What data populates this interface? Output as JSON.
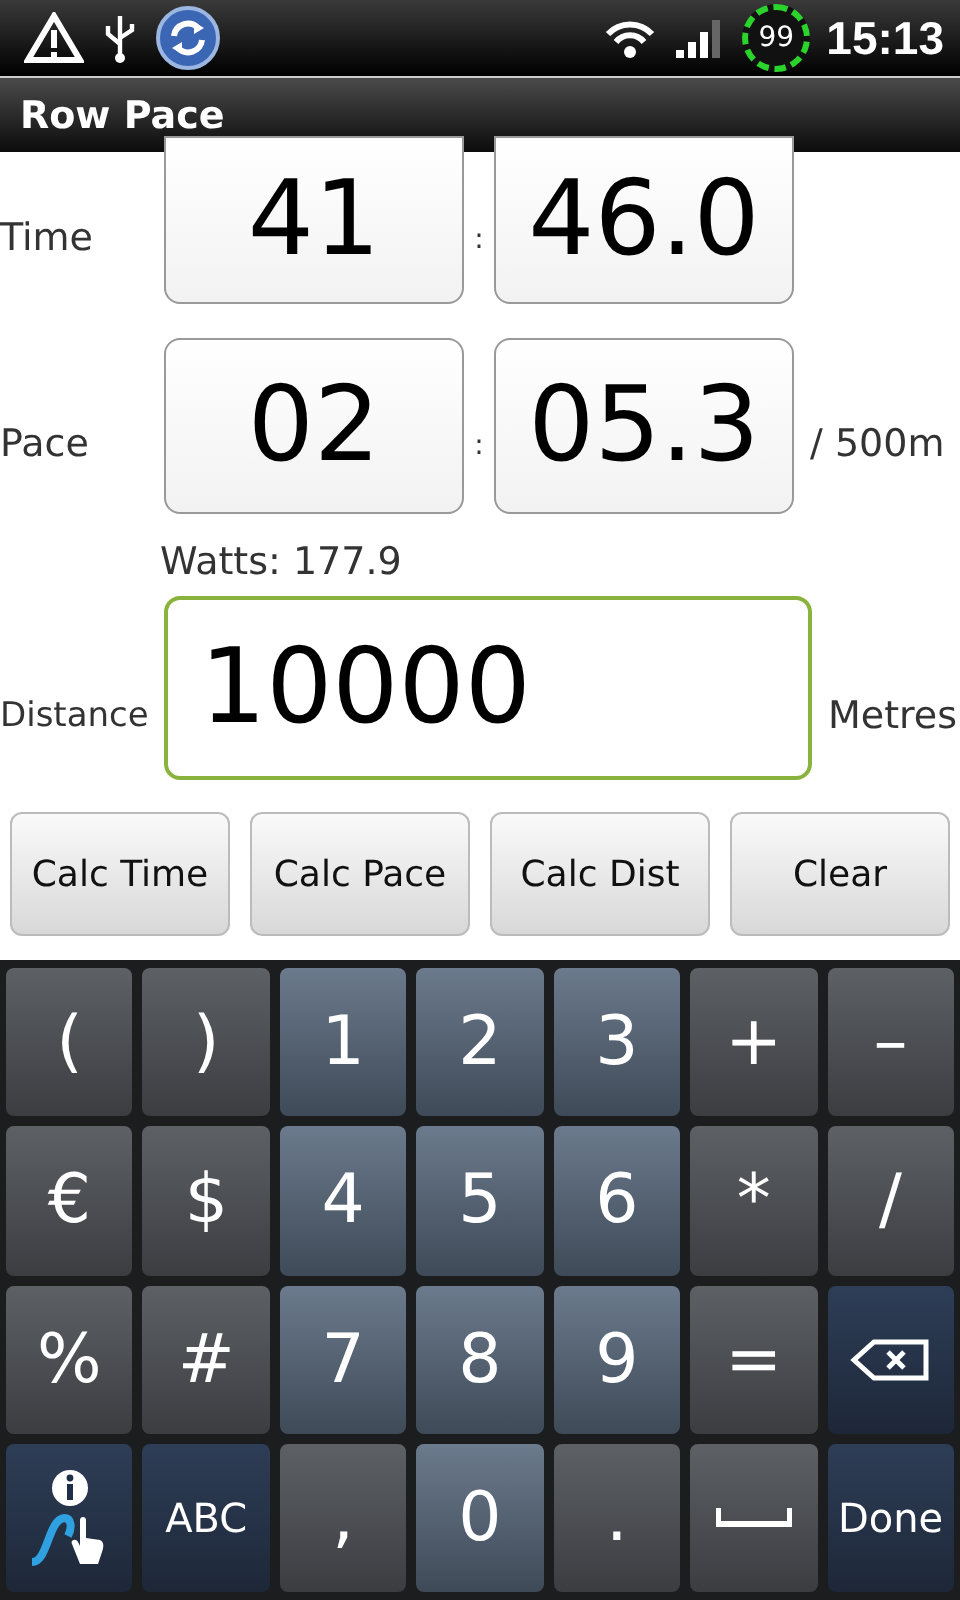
{
  "status_bar": {
    "battery": "99",
    "time": "15:13"
  },
  "title": "Row Pace",
  "rows": [
    {
      "label": "Time",
      "fields": [
        {
          "value": "41",
          "focused": false
        },
        {
          "value": "46.0",
          "focused": false
        }
      ],
      "separator": ":"
    },
    {
      "label": "Pace",
      "fields": [
        {
          "value": "02",
          "focused": false
        },
        {
          "value": "05.3",
          "focused": false
        }
      ],
      "separator": ":",
      "unit": "/ 500m"
    }
  ],
  "watts": "Watts: 177.9",
  "distance": {
    "label": "Distance",
    "value": "10000",
    "focused": true,
    "unit": "Metres"
  },
  "buttons": [
    "Calc Time",
    "Calc Pace",
    "Calc Dist",
    "Clear"
  ],
  "keyboard": [
    {
      "kind": "symbol",
      "label": "("
    },
    {
      "kind": "symbol",
      "label": ")"
    },
    {
      "kind": "digit",
      "label": "1"
    },
    {
      "kind": "digit",
      "label": "2"
    },
    {
      "kind": "digit",
      "label": "3"
    },
    {
      "kind": "symbol",
      "label": "+"
    },
    {
      "kind": "symbol",
      "label": "–"
    },
    {
      "kind": "symbol",
      "label": "€"
    },
    {
      "kind": "symbol",
      "label": "$"
    },
    {
      "kind": "digit",
      "label": "4"
    },
    {
      "kind": "digit",
      "label": "5"
    },
    {
      "kind": "digit",
      "label": "6"
    },
    {
      "kind": "symbol",
      "label": "*"
    },
    {
      "kind": "symbol",
      "label": "/"
    },
    {
      "kind": "symbol",
      "label": "%"
    },
    {
      "kind": "symbol",
      "label": "#"
    },
    {
      "kind": "digit",
      "label": "7"
    },
    {
      "kind": "digit",
      "label": "8"
    },
    {
      "kind": "digit",
      "label": "9"
    },
    {
      "kind": "symbol",
      "label": "="
    },
    {
      "kind": "backspace"
    },
    {
      "kind": "logo"
    },
    {
      "kind": "mode",
      "label": "ABC"
    },
    {
      "kind": "symbol",
      "label": ","
    },
    {
      "kind": "digit",
      "label": "0"
    },
    {
      "kind": "symbol",
      "label": "."
    },
    {
      "kind": "space"
    },
    {
      "kind": "mode",
      "label": "Done"
    }
  ]
}
